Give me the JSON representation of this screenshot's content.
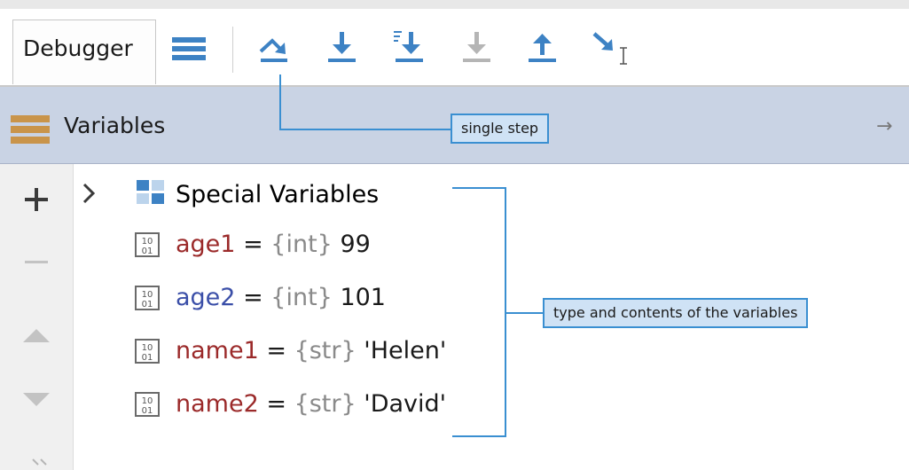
{
  "toolbar": {
    "tab_label": "Debugger",
    "buttons": [
      {
        "icon": "menu-icon",
        "color": "#3d82c4"
      },
      {
        "icon": "step-over-icon",
        "color": "#3d82c4"
      },
      {
        "icon": "step-into-icon",
        "color": "#3d82c4"
      },
      {
        "icon": "step-into-my-code-icon",
        "color": "#3d82c4"
      },
      {
        "icon": "force-step-into-icon",
        "color": "#b5b5b5"
      },
      {
        "icon": "step-out-icon",
        "color": "#3d82c4"
      },
      {
        "icon": "run-to-cursor-icon",
        "color": "#3d82c4"
      }
    ]
  },
  "variables_panel": {
    "title": "Variables",
    "special_label": "Special Variables",
    "items": [
      {
        "name": "age1",
        "eq": "=",
        "type": "{int}",
        "value": "99",
        "name_color": "red"
      },
      {
        "name": "age2",
        "eq": "=",
        "type": "{int}",
        "value": "101",
        "name_color": "blue"
      },
      {
        "name": "name1",
        "eq": "=",
        "type": "{str}",
        "value": "'Helen'",
        "name_color": "red"
      },
      {
        "name": "name2",
        "eq": "=",
        "type": "{str}",
        "value": "'David'",
        "name_color": "red"
      }
    ]
  },
  "side_controls": [
    "plus-icon",
    "minus-icon",
    "move-up-icon",
    "move-down-icon",
    "more-icon"
  ],
  "callouts": {
    "single_step": "single step",
    "type_contents": "type and contents of the variables"
  },
  "colors": {
    "accent": "#3d82c4",
    "header_bg": "#c9d3e4",
    "callout_bg": "#cfe2f5",
    "callout_border": "#3a8fd1"
  }
}
